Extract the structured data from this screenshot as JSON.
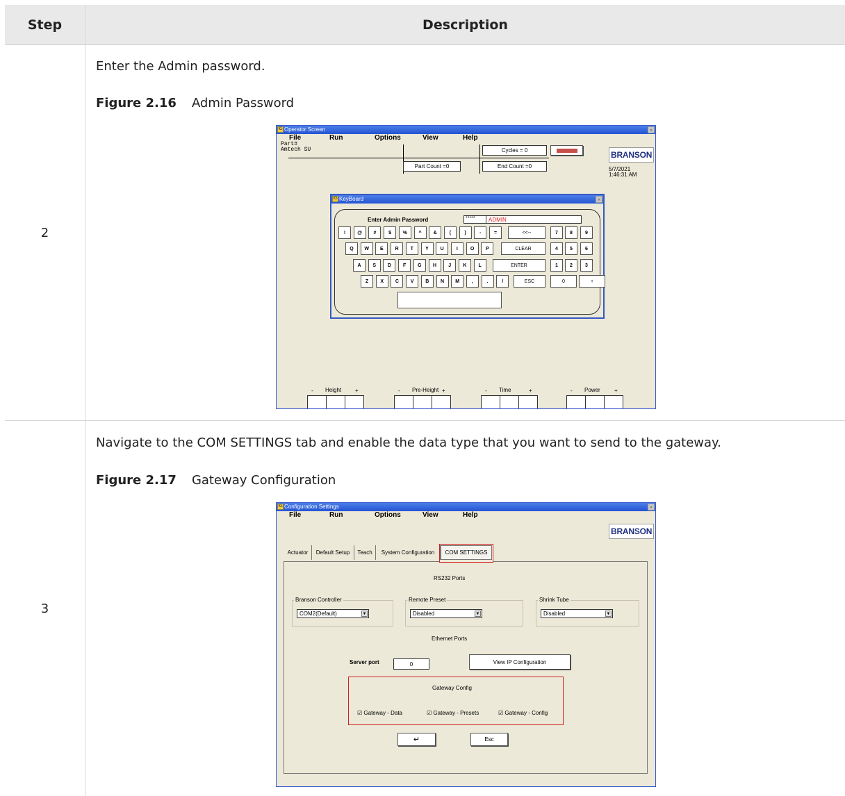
{
  "table": {
    "header_step": "Step",
    "header_description": "Description"
  },
  "rows": [
    {
      "step": "2",
      "text": "Enter the Admin password.",
      "figure_label": "Figure 2.16",
      "figure_title": "Admin Password",
      "shot": {
        "title": "Operator Screen",
        "menu": [
          "File",
          "Run",
          "Options",
          "View",
          "Help"
        ],
        "part_label": "Part#",
        "part_value": "Amtech SU",
        "cycles": "Cycles = 0",
        "part_count": "Part Count =0",
        "end_count": "End Count =0",
        "logo": "BRANSON",
        "date": "5/7/2021",
        "time": "1:46:31 AM",
        "keyboard": {
          "title": "KeyBoard",
          "prompt": "Enter Admin Password",
          "masked": "*****",
          "typed": "ADMIN",
          "row1": [
            "!",
            "@",
            "#",
            "$",
            "%",
            "^",
            "&",
            "(",
            ")",
            "-",
            "="
          ],
          "row2": [
            "Q",
            "W",
            "E",
            "R",
            "T",
            "Y",
            "U",
            "I",
            "O",
            "P"
          ],
          "row3": [
            "A",
            "S",
            "D",
            "F",
            "G",
            "H",
            "J",
            "K",
            "L"
          ],
          "row4": [
            "Z",
            "X",
            "C",
            "V",
            "B",
            "N",
            "M",
            ",",
            ".",
            "/"
          ],
          "backspace": "<<--",
          "clear": "CLEAR",
          "enter": "ENTER",
          "esc": "ESC",
          "numpad": [
            "7",
            "8",
            "9",
            "4",
            "5",
            "6",
            "1",
            "2",
            "3",
            "0",
            "+"
          ]
        },
        "bottom_groups": [
          {
            "minus": "-",
            "label": "Height",
            "plus": "+"
          },
          {
            "minus": "-",
            "label": "Pre-Height",
            "plus": "+"
          },
          {
            "minus": "-",
            "label": "Time",
            "plus": "+"
          },
          {
            "minus": "-",
            "label": "Power",
            "plus": "+"
          }
        ]
      }
    },
    {
      "step": "3",
      "text": "Navigate to the COM SETTINGS tab and enable the data type that you want to send to the gateway.",
      "figure_label": "Figure 2.17",
      "figure_title": "Gateway Configuration",
      "shot": {
        "title": "Configuration Settings",
        "menu": [
          "File",
          "Run",
          "Options",
          "View",
          "Help"
        ],
        "logo": "BRANSON",
        "tabs": [
          "Actuator",
          "Default Setup",
          "Teach",
          "System Configuration",
          "COM SETTINGS"
        ],
        "rs232_heading": "RS232 Ports",
        "groups": [
          {
            "label": "Branson Controller",
            "value": "COM2(Default)"
          },
          {
            "label": "Remote Preset",
            "value": "Disabled"
          },
          {
            "label": "Shrink Tube",
            "value": "Disabled"
          }
        ],
        "ethernet_heading": "Ethernet Ports",
        "server_port_label": "Server port",
        "server_port_value": "0",
        "view_ip": "View IP Configuration",
        "gateway_heading": "Gateway Config",
        "checks": [
          "Gateway - Data",
          "Gateway - Presets",
          "Gateway - Config"
        ],
        "ok_glyph": "↵",
        "esc": "Esc"
      }
    }
  ]
}
